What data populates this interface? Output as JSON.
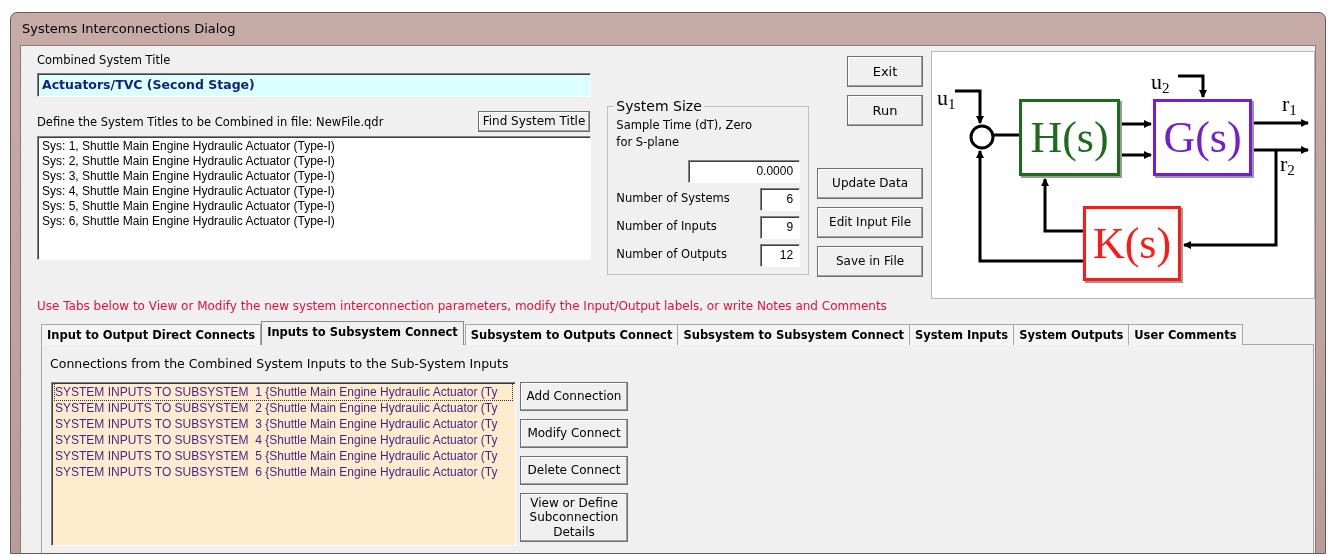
{
  "window": {
    "title": "Systems Interconnections Dialog"
  },
  "combined_title": {
    "label": "Combined System Title",
    "value": "Actuators/TVC (Second Stage)"
  },
  "define_label": "Define the System Titles to be Combined in file: NewFile.qdr",
  "find_button": "Find System Title",
  "systems": [
    "Sys: 1, Shuttle Main Engine Hydraulic Actuator (Type-I)",
    "Sys: 2, Shuttle Main Engine Hydraulic Actuator (Type-I)",
    "Sys: 3, Shuttle Main Engine Hydraulic Actuator (Type-I)",
    "Sys: 4, Shuttle Main Engine Hydraulic Actuator (Type-I)",
    "Sys: 5, Shuttle Main Engine Hydraulic Actuator (Type-I)",
    "Sys: 6, Shuttle Main Engine Hydraulic Actuator (Type-I)"
  ],
  "system_size": {
    "legend": "System Size",
    "sample_time_label": "Sample Time (dT), Zero for S-plane",
    "sample_time": "0.0000",
    "fields": [
      {
        "label": "Number of Systems",
        "value": "6"
      },
      {
        "label": "Number of Inputs",
        "value": "9"
      },
      {
        "label": "Number of Outputs",
        "value": "12"
      }
    ]
  },
  "top_buttons": [
    "Exit",
    "Run"
  ],
  "side_buttons": [
    "Update Data",
    "Edit Input File",
    "Save in File"
  ],
  "diagram": {
    "blocks": [
      {
        "label": "H(s)",
        "color": "#1e6b1e"
      },
      {
        "label": "G(s)",
        "color": "#7020d0"
      },
      {
        "label": "K(s)",
        "color": "#ff1a1a"
      }
    ],
    "signals": [
      "u$_{1}$",
      "u$_{2}$",
      "r$_{1}$",
      "r$_{2}$"
    ]
  },
  "note": "Use Tabs below to View or Modify the new system interconnection parameters, modify the Input/Output labels, or write Notes and Comments",
  "tabs": [
    {
      "label": "Input to Output Direct Connects",
      "selected": false
    },
    {
      "label": "Inputs to Subsystem Connect",
      "selected": true
    },
    {
      "label": "Subsystem to Outputs Connect",
      "selected": false
    },
    {
      "label": "Subsystem to Subsystem Connect",
      "selected": false
    },
    {
      "label": "System Inputs",
      "selected": false
    },
    {
      "label": "System Outputs",
      "selected": false
    },
    {
      "label": "User Comments",
      "selected": false
    }
  ],
  "panel": {
    "heading": "Connections from the Combined System Inputs to the Sub-System Inputs",
    "connections": [
      {
        "text": "SYSTEM INPUTS TO SUBSYSTEM  1 {Shuttle Main Engine Hydraulic Actuator (Ty",
        "selected": true
      },
      {
        "text": "SYSTEM INPUTS TO SUBSYSTEM  2 {Shuttle Main Engine Hydraulic Actuator (Ty",
        "selected": false
      },
      {
        "text": "SYSTEM INPUTS TO SUBSYSTEM  3 {Shuttle Main Engine Hydraulic Actuator (Ty",
        "selected": false
      },
      {
        "text": "SYSTEM INPUTS TO SUBSYSTEM  4 {Shuttle Main Engine Hydraulic Actuator (Ty",
        "selected": false
      },
      {
        "text": "SYSTEM INPUTS TO SUBSYSTEM  5 {Shuttle Main Engine Hydraulic Actuator (Ty",
        "selected": false
      },
      {
        "text": "SYSTEM INPUTS TO SUBSYSTEM  6 {Shuttle Main Engine Hydraulic Actuator (Ty",
        "selected": false
      }
    ],
    "buttons": [
      "Add Connection",
      "Modify Connect",
      "Delete Connect",
      "View or Define Subconnection Details"
    ]
  }
}
